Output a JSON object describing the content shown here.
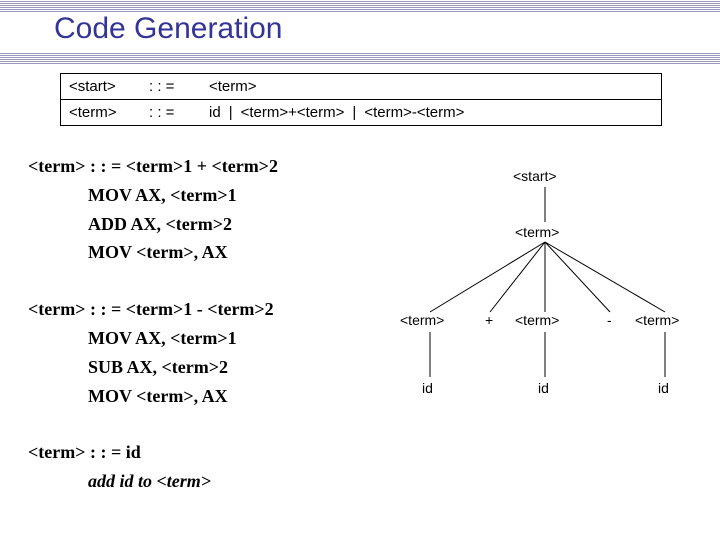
{
  "title": "Code Generation",
  "grammar": {
    "row1": {
      "lhs": "<start>",
      "op": ": : =",
      "rhs": "<term>"
    },
    "row2": {
      "lhs": "<term>",
      "op": ": : =",
      "alt1": "id",
      "alt2": "<term>+<term>",
      "alt3": "<term>-<term>"
    }
  },
  "rules": {
    "add": {
      "head": "<term> : : = <term>1 + <term>2",
      "l1": "MOV  AX, <term>1",
      "l2": "ADD   AX, <term>2",
      "l3": "MOV   <term>, AX"
    },
    "sub": {
      "head": "<term> : : = <term>1 -  <term>2",
      "l1": "MOV  AX, <term>1",
      "l2": "SUB    AX, <term>2",
      "l3": "MOV   <term>, AX"
    },
    "id": {
      "head": "<term> : : = id",
      "l1": "add id to <term>"
    }
  },
  "tree": {
    "start": "<start>",
    "term": "<term>",
    "t1": "<term>",
    "t2": "<term>",
    "t3": "<term>",
    "plus": "+",
    "minus": "-",
    "id1": "id",
    "id2": "id",
    "id3": "id"
  }
}
